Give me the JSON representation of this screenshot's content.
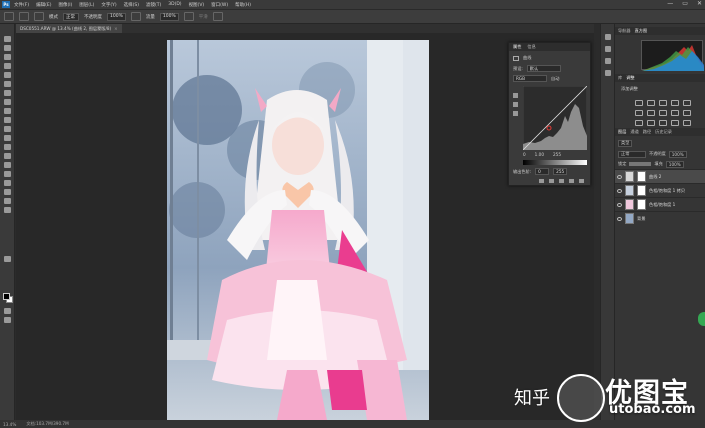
{
  "menubar": {
    "logo": "Ps",
    "items": [
      "文件(F)",
      "编辑(E)",
      "图像(I)",
      "图层(L)",
      "文字(Y)",
      "选择(S)",
      "滤镜(T)",
      "3D(D)",
      "视图(V)",
      "窗口(W)",
      "帮助(H)"
    ],
    "window_controls": [
      "—",
      "▭",
      "✕"
    ]
  },
  "options_bar": {
    "style_label": "羽化",
    "mode_label": "模式",
    "mode_value": "正常",
    "opacity_label": "不透明度",
    "opacity_value": "100%",
    "flow_label": "流量",
    "flow_value": "100%",
    "smoothing_label": "平滑"
  },
  "document_tab": {
    "title": "DSC0551.ARW @ 13.4% (曲线 2, 图层蒙版/8)",
    "close": "×"
  },
  "status_bar": {
    "zoom": "13.4%",
    "doc_info": "文档:103.7M/390.7M"
  },
  "right_dock": {
    "top_tabs": [
      "导航器",
      "直方图"
    ],
    "adjust_tabs": [
      "库",
      "调整"
    ],
    "adjust_title": "添加调整",
    "layer_tabs": [
      "图层",
      "通道",
      "路径",
      "历史记录"
    ],
    "kind_label": "类型",
    "blend_mode": "正常",
    "opacity_label": "不透明度",
    "opacity_value": "100%",
    "lock_label": "锁定",
    "fill_label": "填充",
    "fill_value": "100%",
    "layers": [
      {
        "name": "曲线 2",
        "selected": true,
        "thumb_color": "#d9d9d9"
      },
      {
        "name": "色相/饱和度 1 拷贝",
        "selected": false,
        "thumb_color": "#c6d0de"
      },
      {
        "name": "色相/饱和度 1",
        "selected": false,
        "thumb_color": "#f0c8dc"
      },
      {
        "name": "背景",
        "selected": false,
        "thumb_color": "#93a8c4"
      }
    ]
  },
  "properties_panel": {
    "tabs": [
      "属性",
      "信息"
    ],
    "title": "曲线",
    "preset_label": "预设:",
    "preset_value": "默认",
    "channel_value": "RGB",
    "auto_label": "自动",
    "input_label": "输入色阶:",
    "input_values": [
      "0",
      "1.00",
      "255"
    ],
    "output_label": "输出色阶:",
    "output_values": [
      "0",
      "255"
    ]
  },
  "watermark": {
    "text": "知乎",
    "brand": "优图宝",
    "domain": "utobao.com"
  }
}
